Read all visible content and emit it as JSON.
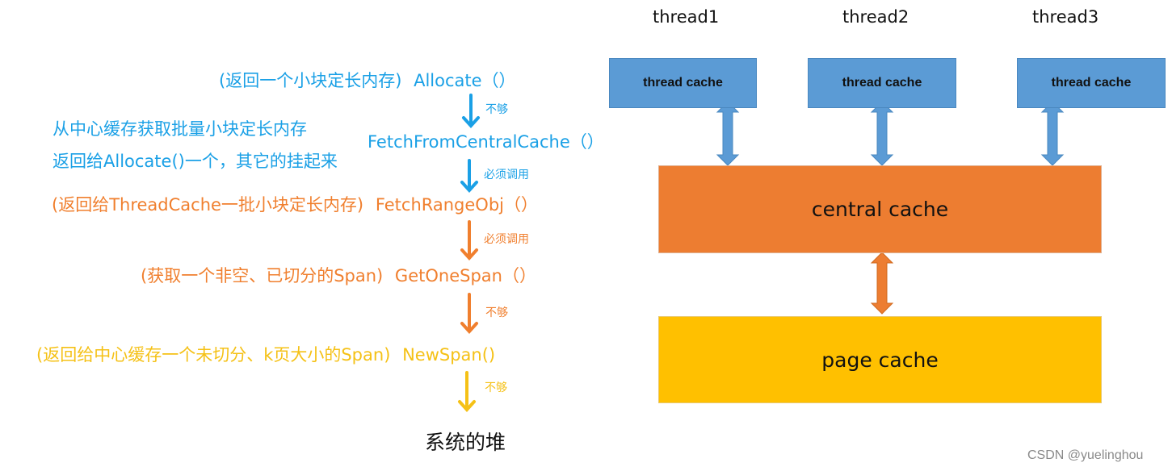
{
  "flow": {
    "step1": {
      "note": "(返回一个小块定长内存)",
      "func": "Allocate（）"
    },
    "arrow1_label": "不够",
    "step2": {
      "note_line1": "从中心缓存获取批量小块定长内存",
      "note_line2": "返回给Allocate()一个，其它的挂起来",
      "func": "FetchFromCentralCache（）"
    },
    "arrow2_label": "必须调用",
    "step3": {
      "note": "(返回给ThreadCache一批小块定长内存)",
      "func": "FetchRangeObj（）"
    },
    "arrow3_label": "必须调用",
    "step4": {
      "note": "(获取一个非空、已切分的Span)",
      "func": "GetOneSpan（）"
    },
    "arrow4_label": "不够",
    "step5": {
      "note": "(返回给中心缓存一个未切分、k页大小的Span)",
      "func": "NewSpan()"
    },
    "arrow5_label": "不够",
    "final": "系统的堆"
  },
  "architecture": {
    "threads": [
      {
        "label": "thread1",
        "cache": "thread cache"
      },
      {
        "label": "thread2",
        "cache": "thread cache"
      },
      {
        "label": "thread3",
        "cache": "thread cache"
      }
    ],
    "central": "central cache",
    "page": "page cache"
  },
  "colors": {
    "blue_text": "#1aa0e6",
    "orange_text": "#f07f2e",
    "yellow_text": "#f5c116",
    "thread_cache": "#5b9bd5",
    "central_cache": "#ed7d31",
    "page_cache": "#ffc000"
  },
  "watermark": "CSDN @yuelinghou"
}
